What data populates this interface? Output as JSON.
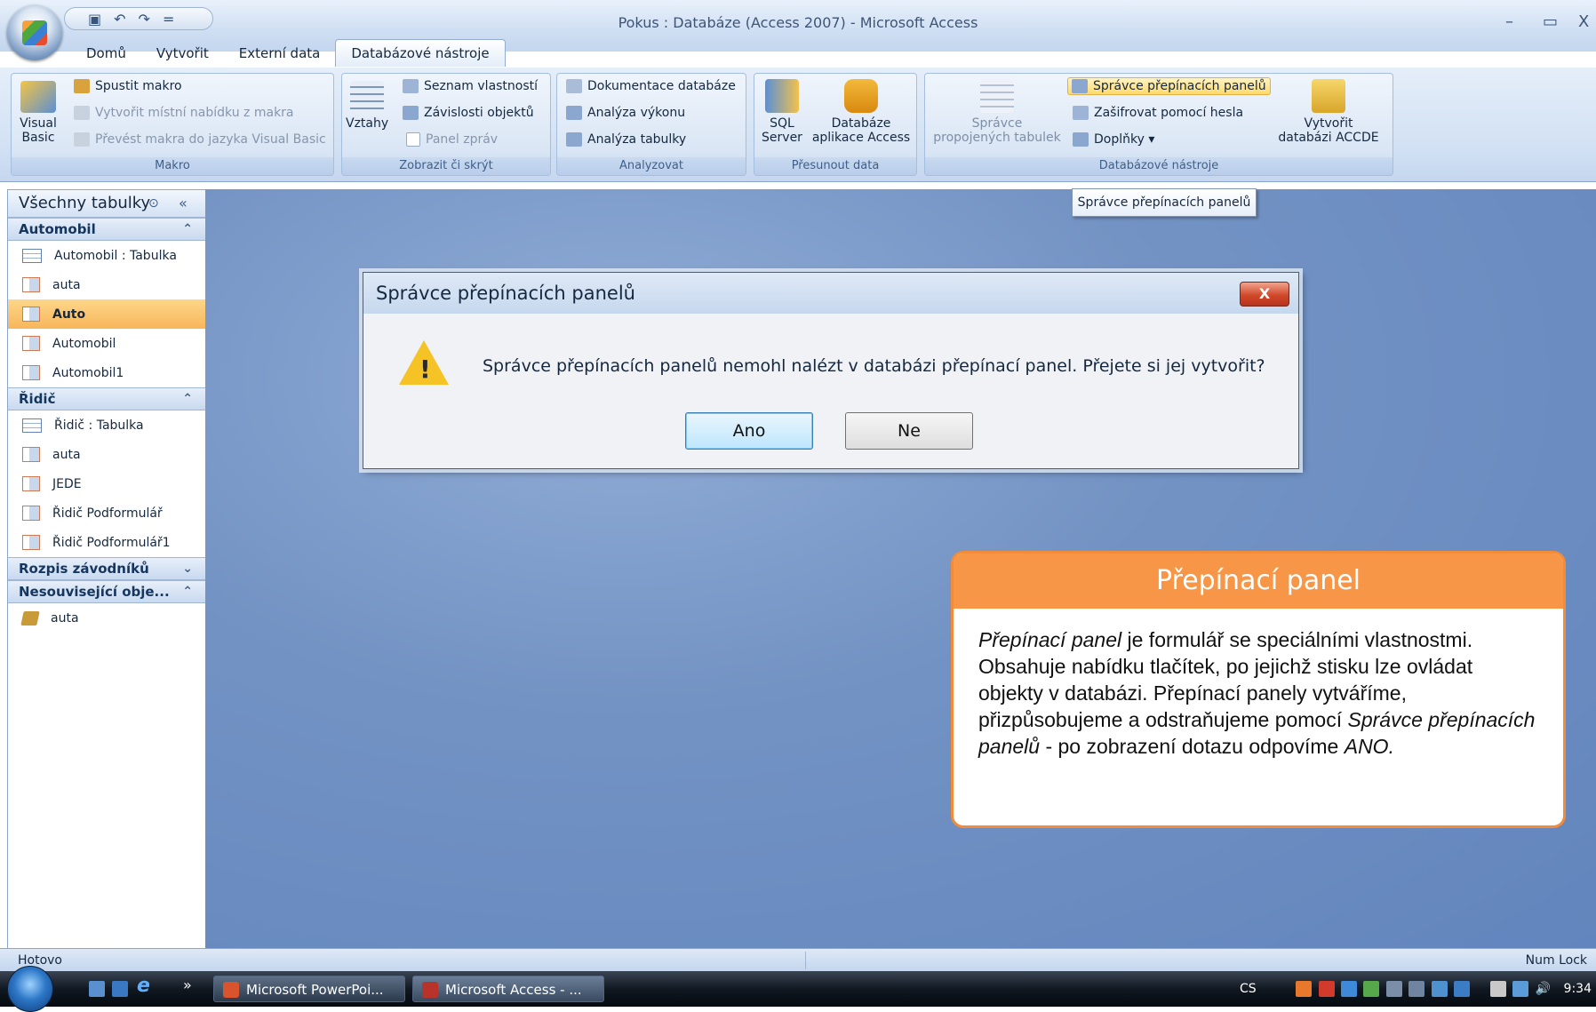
{
  "window": {
    "title": "Pokus : Databáze (Access 2007) - Microsoft Access",
    "minimize": "–",
    "restore": "▭",
    "close": "X"
  },
  "qat": {
    "save_icon": "save-icon",
    "undo": "↶",
    "redo": "↷",
    "more": "="
  },
  "tabs": [
    {
      "label": "Domů",
      "active": false
    },
    {
      "label": "Vytvořit",
      "active": false
    },
    {
      "label": "Externí data",
      "active": false
    },
    {
      "label": "Databázové nástroje",
      "active": true
    }
  ],
  "ribbon": {
    "makro": {
      "label": "Makro",
      "visual_basic": "Visual Basic",
      "spustit": "Spustit makro",
      "vytvorit_nabidku": "Vytvořit místní nabídku z makra",
      "prevest": "Převést makra do jazyka Visual Basic"
    },
    "zobrazit": {
      "label": "Zobrazit či skrýt",
      "vztahy": "Vztahy",
      "seznam": "Seznam vlastností",
      "zavislosti": "Závislosti objektů",
      "panel_zprav": "Panel zpráv"
    },
    "analyzovat": {
      "label": "Analyzovat",
      "dokumentace": "Dokumentace databáze",
      "vykon": "Analýza výkonu",
      "tabulka": "Analýza tabulky"
    },
    "presunout": {
      "label": "Přesunout data",
      "sql_line1": "SQL",
      "sql_line2": "Server",
      "access_line1": "Databáze",
      "access_line2": "aplikace Access"
    },
    "nastroje": {
      "label": "Databázové nástroje",
      "spravce_prop_line1": "Správce",
      "spravce_prop_line2": "propojených tabulek",
      "spravce_panelu": "Správce přepínacích panelů",
      "zasifrovat": "Zašifrovat pomocí hesla",
      "doplnky": "Doplňky ▾",
      "accde_line1": "Vytvořit",
      "accde_line2": "databázi ACCDE"
    }
  },
  "tooltip": "Správce přepínacích panelů",
  "nav": {
    "header": "Všechny tabulky",
    "groups": [
      {
        "label": "Automobil",
        "items": [
          {
            "label": "Automobil : Tabulka",
            "type": "table",
            "selected": false
          },
          {
            "label": "auta",
            "type": "form",
            "selected": false
          },
          {
            "label": "Auto",
            "type": "form",
            "selected": true
          },
          {
            "label": "Automobil",
            "type": "form",
            "selected": false
          },
          {
            "label": "Automobil1",
            "type": "form",
            "selected": false
          }
        ]
      },
      {
        "label": "Řidič",
        "items": [
          {
            "label": "Řidič : Tabulka",
            "type": "table",
            "selected": false
          },
          {
            "label": "auta",
            "type": "form",
            "selected": false
          },
          {
            "label": "JEDE",
            "type": "form",
            "selected": false
          },
          {
            "label": "Řidič Podformulář",
            "type": "form",
            "selected": false
          },
          {
            "label": "Řidič Podformulář1",
            "type": "form",
            "selected": false
          }
        ]
      },
      {
        "label": "Rozpis závodníků",
        "items": []
      },
      {
        "label": "Nesouvisející obje...",
        "items": [
          {
            "label": "auta",
            "type": "macro",
            "selected": false
          }
        ]
      }
    ]
  },
  "dialog": {
    "title": "Správce přepínacích panelů",
    "close": "X",
    "message": "Správce přepínacích panelů nemohl nalézt v databázi přepínací panel. Přejete si jej vytvořit?",
    "yes": "Ano",
    "no": "Ne"
  },
  "info": {
    "title": "Přepínací panel",
    "t1": "Přepínací panel",
    "t2": " je formulář se speciálními vlastnostmi. Obsahuje nabídku tlačítek, po jejichž stisku lze ovládat objekty v databázi. Přepínací panely vytváříme, přizpůsobujeme  a odstraňujeme pomocí ",
    "t3": "Správce přepínacích panelů",
    "t4": " - po zobrazení dotazu odpovíme ",
    "t5": "ANO."
  },
  "status": {
    "left": "Hotovo",
    "right": "Num Lock"
  },
  "taskbar": {
    "tasks": [
      {
        "label": "Microsoft PowerPoi...",
        "active": false
      },
      {
        "label": "Microsoft Access - ...",
        "active": true
      }
    ],
    "quicklaunch_more": "»",
    "lang": "CS",
    "time": "9:34"
  },
  "colors": {
    "accent_orange": "#f79646",
    "selected_nav": "#f8b65a",
    "workspace": "#6d8fc3"
  }
}
